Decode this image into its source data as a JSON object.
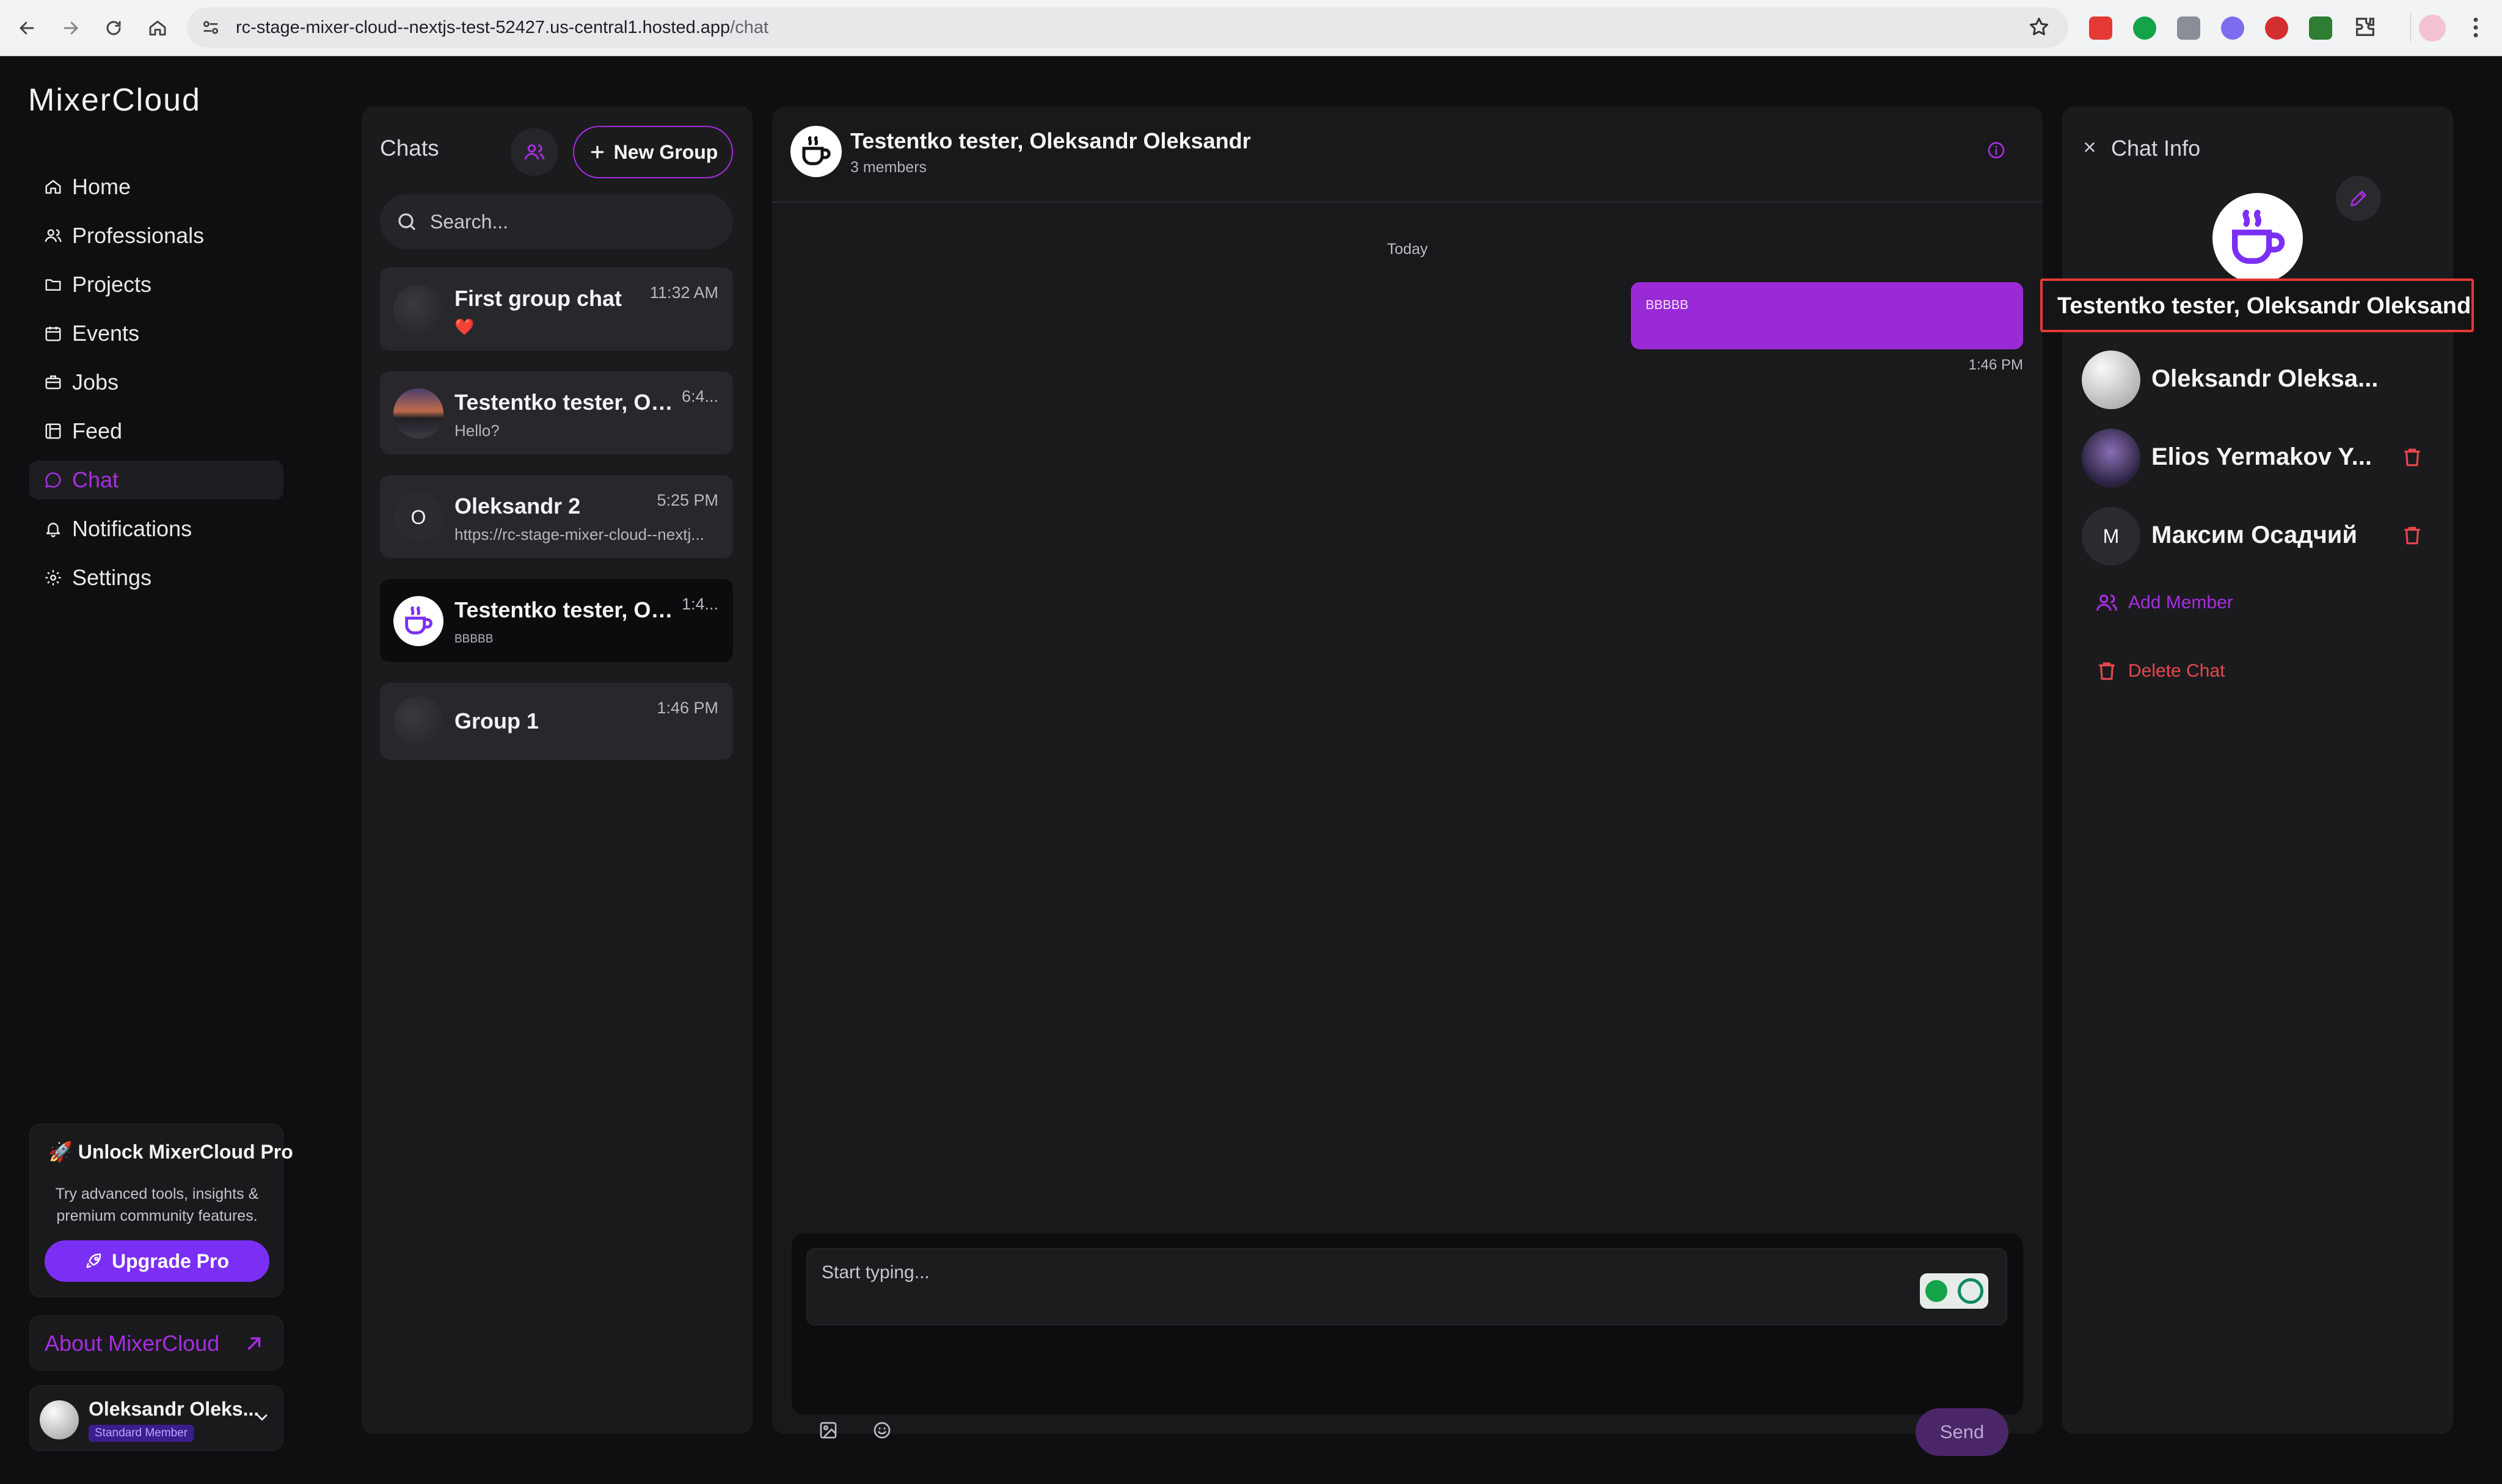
{
  "browser": {
    "url_domain": "rc-stage-mixer-cloud--nextjs-test-52427.us-central1.hosted.app",
    "url_path": "/chat"
  },
  "app": {
    "logo": "MixerCloud",
    "nav": [
      {
        "label": "Home",
        "icon": "home-icon"
      },
      {
        "label": "Professionals",
        "icon": "users-icon"
      },
      {
        "label": "Projects",
        "icon": "folder-icon"
      },
      {
        "label": "Events",
        "icon": "calendar-icon"
      },
      {
        "label": "Jobs",
        "icon": "briefcase-icon"
      },
      {
        "label": "Feed",
        "icon": "feed-icon"
      },
      {
        "label": "Chat",
        "icon": "chat-icon",
        "active": true
      },
      {
        "label": "Notifications",
        "icon": "bell-icon"
      },
      {
        "label": "Settings",
        "icon": "gear-icon"
      }
    ],
    "promo": {
      "title": "🚀 Unlock MixerCloud Pro",
      "desc1": "Try advanced tools, insights &",
      "desc2": "premium community features.",
      "button": "Upgrade Pro"
    },
    "about": "About MixerCloud",
    "user": {
      "name": "Oleksandr Oleks...",
      "badge": "Standard Member"
    },
    "accent": "#a62ee0",
    "danger": "#e5484d"
  },
  "chats": {
    "title": "Chats",
    "new_group": "New Group",
    "search_placeholder": "Search...",
    "items": [
      {
        "name": "First group chat",
        "preview": "❤️",
        "time": "11:32 AM"
      },
      {
        "name": "Testentko tester, Olek...",
        "preview": "Hello?",
        "time": "6:4..."
      },
      {
        "name": "Oleksandr 2",
        "preview": "https://rc-stage-mixer-cloud--nextj...",
        "time": "5:25 PM",
        "initial": "O"
      },
      {
        "name": "Testentko tester, Olek...",
        "preview": "BBBBB",
        "time": "1:4...",
        "selected": true
      },
      {
        "name": "Group 1",
        "preview": "",
        "time": "1:46 PM"
      }
    ]
  },
  "conversation": {
    "title": "Testentko tester, Oleksandr Oleksandr",
    "subtitle": "3 members",
    "day_label": "Today",
    "messages": [
      {
        "text": "BBBBB",
        "time": "1:46 PM"
      }
    ],
    "input_placeholder": "Start typing...",
    "send": "Send"
  },
  "info": {
    "title": "Chat Info",
    "name_value": "Testentko tester, Oleksandr Oleksandr",
    "members": [
      {
        "name": "Oleksandr Oleksa...",
        "removable": false
      },
      {
        "name": "Elios Yermakov Y...",
        "removable": true
      },
      {
        "name": "Максим Осадчий",
        "initial": "M",
        "removable": true
      }
    ],
    "add_member": "Add Member",
    "delete_chat": "Delete Chat"
  }
}
